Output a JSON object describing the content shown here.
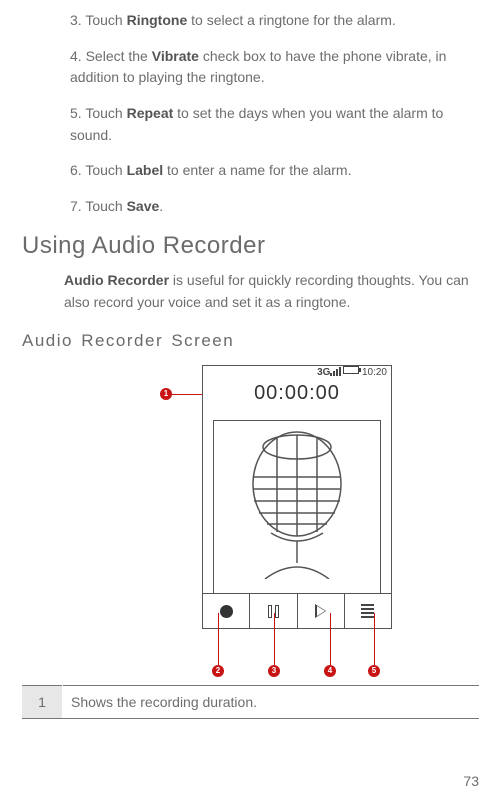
{
  "steps": [
    {
      "num": "3.",
      "before": "Touch ",
      "bold": "Ringtone",
      "after": " to select a ringtone for the alarm."
    },
    {
      "num": "4.",
      "before": "Select the ",
      "bold": "Vibrate",
      "after": " check box to have the phone vibrate, in addition to playing the ringtone."
    },
    {
      "num": "5.",
      "before": "Touch ",
      "bold": "Repeat",
      "after": " to set the days when you want the alarm to sound."
    },
    {
      "num": "6.",
      "before": "Touch ",
      "bold": "Label",
      "after": " to enter a name for the alarm."
    },
    {
      "num": "7.",
      "before": "Touch ",
      "bold": "Save",
      "after": "."
    }
  ],
  "section_title": "Using Audio Recorder",
  "intro_bold": "Audio Recorder",
  "intro_rest": " is useful for quickly recording thoughts. You can also record your voice and set it as a ringtone.",
  "subsection_title": "Audio Recorder Screen",
  "recorder": {
    "status_clock": "10:20",
    "status_3g": "3G",
    "timer": "00:00:00"
  },
  "callouts": {
    "c1": "1",
    "c2": "2",
    "c3": "3",
    "c4": "4",
    "c5": "5"
  },
  "legend": [
    {
      "idx": "1",
      "desc": "Shows the recording duration."
    }
  ],
  "page_number": "73"
}
